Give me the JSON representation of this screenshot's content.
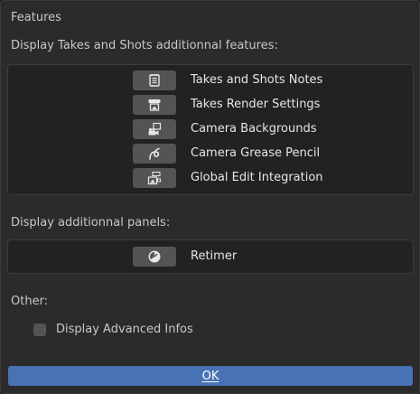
{
  "dialog": {
    "title": "Features",
    "takes_section_label": "Display Takes and Shots additionnal features:",
    "takes_features": [
      {
        "label": "Takes and Shots Notes",
        "icon": "notes-icon"
      },
      {
        "label": "Takes Render Settings",
        "icon": "render-settings-icon"
      },
      {
        "label": "Camera Backgrounds",
        "icon": "camera-backgrounds-icon"
      },
      {
        "label": "Camera Grease Pencil",
        "icon": "grease-pencil-icon"
      },
      {
        "label": "Global Edit Integration",
        "icon": "global-edit-icon"
      }
    ],
    "panels_section_label": "Display additionnal panels:",
    "panels": [
      {
        "label": "Retimer",
        "icon": "retimer-clock-icon"
      }
    ],
    "other_section_label": "Other:",
    "advanced_infos": {
      "label": "Display Advanced Infos",
      "checked": false
    },
    "ok_label": "OK"
  },
  "colors": {
    "background": "#2b2b2b",
    "panel": "#222222",
    "button": "#545454",
    "accent": "#4772b3",
    "text": "#e6e6e6"
  }
}
